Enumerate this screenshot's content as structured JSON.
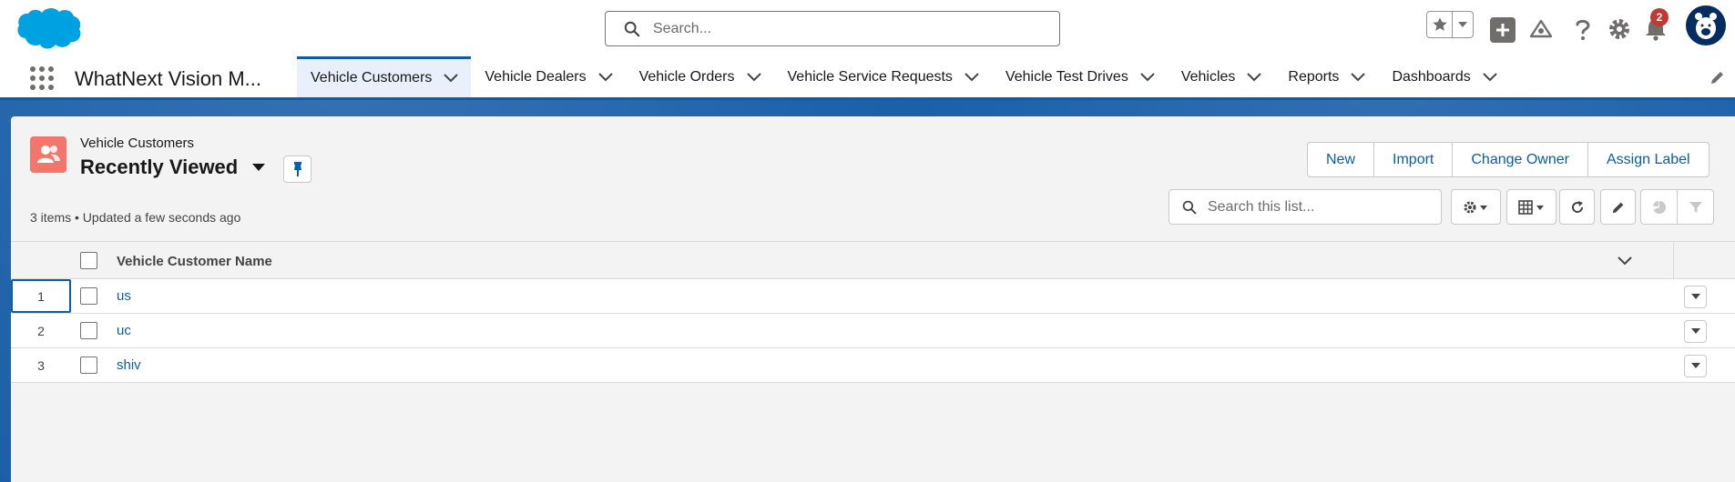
{
  "header": {
    "search_placeholder": "Search...",
    "notification_count": "2",
    "brand_color": "#00a1e0"
  },
  "nav": {
    "app_name": "WhatNext Vision M...",
    "tabs": [
      {
        "label": "Vehicle Customers",
        "active": true
      },
      {
        "label": "Vehicle Dealers"
      },
      {
        "label": "Vehicle Orders"
      },
      {
        "label": "Vehicle Service Requests"
      },
      {
        "label": "Vehicle Test Drives"
      },
      {
        "label": "Vehicles"
      },
      {
        "label": "Reports"
      },
      {
        "label": "Dashboards"
      }
    ]
  },
  "list_view": {
    "object_label": "Vehicle Customers",
    "view_name": "Recently Viewed",
    "status": "3 items • Updated a few seconds ago",
    "search_placeholder": "Search this list...",
    "actions": {
      "new": "New",
      "import": "Import",
      "change_owner": "Change Owner",
      "assign_label": "Assign Label"
    },
    "toolbar_icons": [
      "gear-icon",
      "table-icon",
      "refresh-icon",
      "pencil-icon",
      "chart-icon",
      "filter-icon"
    ]
  },
  "table": {
    "column_header": "Vehicle Customer Name",
    "rows": [
      {
        "num": "1",
        "name": "us"
      },
      {
        "num": "2",
        "name": "uc"
      },
      {
        "num": "3",
        "name": "shiv"
      }
    ]
  }
}
